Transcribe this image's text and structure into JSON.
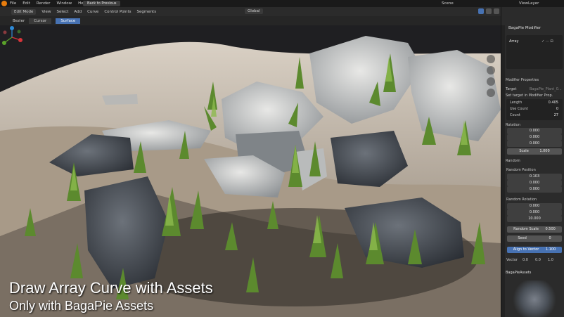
{
  "topbar": {
    "menus": [
      "File",
      "Edit",
      "Render",
      "Window",
      "Help"
    ],
    "back_label": "Back to Previous",
    "scene": "Scene",
    "view_layer": "ViewLayer"
  },
  "header": {
    "mode": "Edit Mode",
    "menus": [
      "View",
      "Select",
      "Add",
      "Curve",
      "Control Points",
      "Segments"
    ],
    "orientation": "Global"
  },
  "toolsettings": {
    "curve_type": "Bezier",
    "cursor_label": "Cursor",
    "surface_label": "Surface"
  },
  "viewport": {
    "caption_line1": "Draw Array Curve with Assets",
    "caption_line2": "Only with BagaPie Assets"
  },
  "panel": {
    "title": "BagaPie Modifier",
    "modifier_name": "Array",
    "props_header": "Modifier Properties",
    "target_label": "Target",
    "target_placeholder": "BagaPie_Plant_0...",
    "set_target_label": "Set target in Modifier Prop.",
    "length_label": "Length",
    "length_value": "0.405",
    "use_count_label": "Use Count",
    "use_count_value": "0",
    "count_label": "Count",
    "count_value": "27",
    "rotation_label": "Rotation",
    "rotation_values": [
      "0.000",
      "0.000",
      "0.000"
    ],
    "scale_label": "Scale",
    "scale_value": "1.000",
    "random_label": "Random",
    "random_position_label": "Random Position",
    "random_position_values": [
      "0.103",
      "0.000",
      "0.000"
    ],
    "random_rotation_label": "Random Rotation",
    "random_rotation_values": [
      "0.000",
      "0.000",
      "10.000"
    ],
    "random_scale_label": "Random Scale",
    "random_scale_value": "0.500",
    "seed_label": "Seed",
    "seed_value": "0",
    "align_label": "Align to Vector",
    "align_value": "1.100",
    "vector_label": "Vector",
    "vector_values": [
      "0.0",
      "0.0",
      "1.0"
    ],
    "assets_label": "BagaPieAssets"
  },
  "colors": {
    "accent": "#4772b3",
    "blender_orange": "#e87d0d"
  }
}
